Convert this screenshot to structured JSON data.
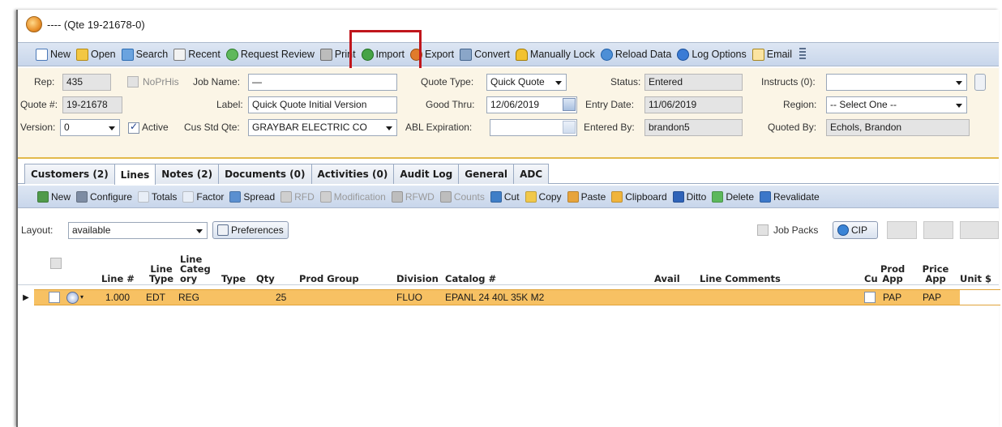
{
  "window": {
    "title": "---- (Qte 19-21678-0)"
  },
  "toolbar": {
    "items": [
      {
        "label": "New",
        "icon": "new-document-icon"
      },
      {
        "label": "Open",
        "icon": "open-folder-icon"
      },
      {
        "label": "Search",
        "icon": "search-icon"
      },
      {
        "label": "Recent",
        "icon": "recent-icon"
      },
      {
        "label": "Request Review",
        "icon": "request-review-icon"
      },
      {
        "label": "Print",
        "icon": "printer-icon"
      },
      {
        "label": "Import",
        "icon": "import-icon"
      },
      {
        "label": "Export",
        "icon": "export-icon"
      },
      {
        "label": "Convert",
        "icon": "convert-icon"
      },
      {
        "label": "Manually Lock",
        "icon": "lock-icon"
      },
      {
        "label": "Reload Data",
        "icon": "reload-icon"
      },
      {
        "label": "Log Options",
        "icon": "log-options-icon"
      },
      {
        "label": "Email",
        "icon": "email-icon"
      }
    ],
    "highlight_color": "#c0161c"
  },
  "form": {
    "rep_label": "Rep:",
    "rep_value": "435",
    "noprhis_label": "NoPrHis",
    "jobname_label": "Job Name:",
    "jobname_value": "—",
    "quotetype_label": "Quote Type:",
    "quotetype_value": "Quick Quote",
    "status_label": "Status:",
    "status_value": "Entered",
    "instructs_label": "Instructs (0):",
    "instructs_value": "",
    "quote_label": "Quote #:",
    "quote_value": "19-21678",
    "label_label": "Label:",
    "label_value": "Quick Quote Initial Version",
    "goodthru_label": "Good Thru:",
    "goodthru_value": "12/06/2019",
    "entrydate_label": "Entry Date:",
    "entrydate_value": "11/06/2019",
    "region_label": "Region:",
    "region_value": "-- Select One --",
    "version_label": "Version:",
    "version_value": "0",
    "active_label": "Active",
    "active_checked": true,
    "cusstd_label": "Cus Std Qte:",
    "cusstd_value": "GRAYBAR ELECTRIC CO",
    "ablexp_label": "ABL Expiration:",
    "ablexp_value": "",
    "enteredby_label": "Entered By:",
    "enteredby_value": "brandon5",
    "quotedby_label": "Quoted By:",
    "quotedby_value": "Echols, Brandon"
  },
  "tabs": [
    {
      "label": "Customers (2)",
      "active": false
    },
    {
      "label": "Lines",
      "active": true
    },
    {
      "label": "Notes (2)",
      "active": false
    },
    {
      "label": "Documents (0)",
      "active": false
    },
    {
      "label": "Activities (0)",
      "active": false
    },
    {
      "label": "Audit Log",
      "active": false
    },
    {
      "label": "General",
      "active": false
    },
    {
      "label": "ADC",
      "active": false
    }
  ],
  "lines_toolbar": [
    {
      "label": "New",
      "icon": "grid-new-icon",
      "color": "#4f9a4a",
      "disabled": false
    },
    {
      "label": "Configure",
      "icon": "configure-icon",
      "color": "#7d8ca3",
      "disabled": false
    },
    {
      "label": "Totals",
      "icon": "sigma-icon",
      "color": "#e8eef7",
      "disabled": false
    },
    {
      "label": "Factor",
      "icon": "factor-icon",
      "color": "#e8eef7",
      "disabled": false
    },
    {
      "label": "Spread",
      "icon": "spread-icon",
      "color": "#5a8fd0",
      "disabled": false
    },
    {
      "label": "RFD",
      "icon": "rfd-icon",
      "color": "#cfcfcf",
      "disabled": true
    },
    {
      "label": "Modification",
      "icon": "modification-icon",
      "color": "#cfcfcf",
      "disabled": true
    },
    {
      "label": "RFWD",
      "icon": "rfwd-icon",
      "color": "#bdbdbd",
      "disabled": true
    },
    {
      "label": "Counts",
      "icon": "counts-icon",
      "color": "#bdbdbd",
      "disabled": true
    },
    {
      "label": "Cut",
      "icon": "cut-icon",
      "color": "#3f7ec7",
      "disabled": false
    },
    {
      "label": "Copy",
      "icon": "copy-icon",
      "color": "#f1c84a",
      "disabled": false
    },
    {
      "label": "Paste",
      "icon": "paste-icon",
      "color": "#e7a43b",
      "disabled": false
    },
    {
      "label": "Clipboard",
      "icon": "clipboard-icon",
      "color": "#f0b43c",
      "disabled": false
    },
    {
      "label": "Ditto",
      "icon": "ditto-icon",
      "color": "#2f63b8",
      "disabled": false
    },
    {
      "label": "Delete",
      "icon": "delete-icon",
      "color": "#5cb85c",
      "disabled": false
    },
    {
      "label": "Revalidate",
      "icon": "revalidate-icon",
      "color": "#3b77c9",
      "disabled": false
    }
  ],
  "layout": {
    "label": "Layout:",
    "value": "available",
    "preferences_label": "Preferences",
    "jobpacks_label": "Job Packs",
    "cip_label": "CIP"
  },
  "grid": {
    "headers": {
      "line_num": "Line #",
      "line_type": "Line Type",
      "line_category": "Line Categ ory",
      "type": "Type",
      "qty": "Qty",
      "prod_group": "Prod Group",
      "division": "Division",
      "catalog": "Catalog #",
      "avail": "Avail",
      "line_comments": "Line Comments",
      "cu": "Cu",
      "prod_app": "Prod App",
      "price_app": "Price App",
      "unit": "Unit $"
    },
    "row": {
      "line_num": "1.000",
      "line_type": "EDT",
      "line_category": "REG",
      "type": "",
      "qty": "25",
      "prod_group": "",
      "division": "FLUO",
      "catalog": "EPANL 24 40L 35K M2",
      "avail": "",
      "line_comments": "",
      "prod_app": "PAP",
      "price_app": "PAP",
      "row_color": "#f7c163"
    }
  }
}
